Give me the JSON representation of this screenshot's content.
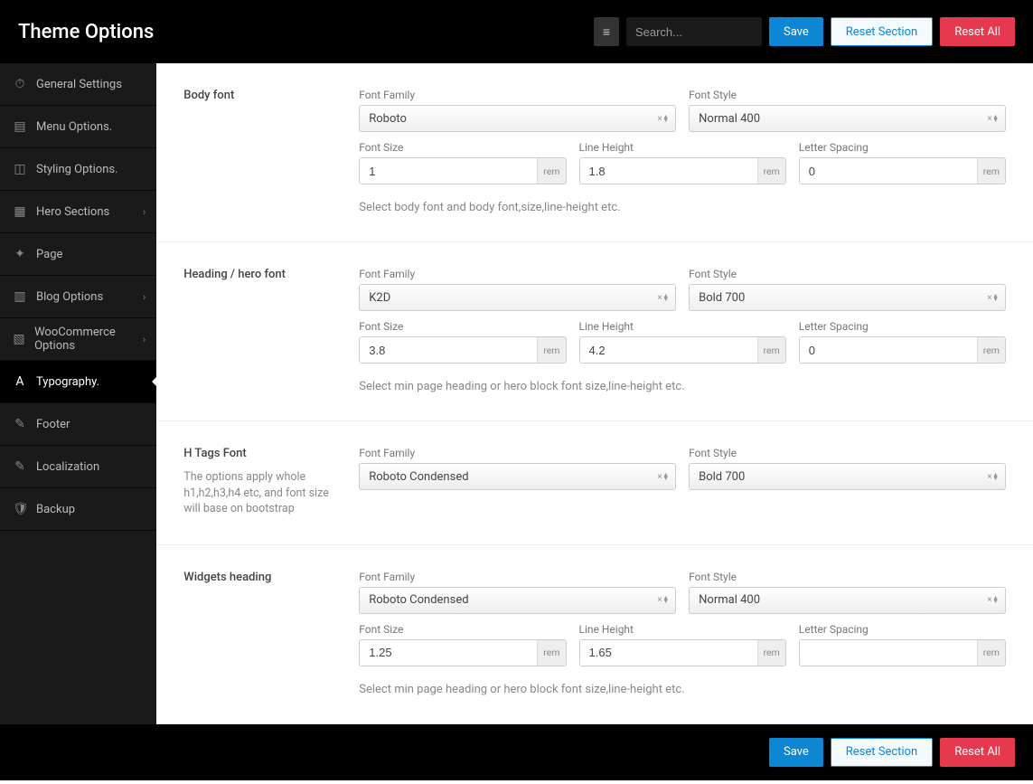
{
  "header": {
    "title": "Theme Options",
    "search_placeholder": "Search...",
    "save": "Save",
    "reset_section": "Reset Section",
    "reset_all": "Reset All"
  },
  "sidebar": {
    "items": [
      {
        "label": "General Settings",
        "icon": "⏱",
        "chevron": false
      },
      {
        "label": "Menu Options.",
        "icon": "▤",
        "chevron": false
      },
      {
        "label": "Styling Options.",
        "icon": "◫",
        "chevron": false
      },
      {
        "label": "Hero Sections",
        "icon": "▦",
        "chevron": true
      },
      {
        "label": "Page",
        "icon": "✦",
        "chevron": false
      },
      {
        "label": "Blog Options",
        "icon": "▥",
        "chevron": true
      },
      {
        "label": "WooCommerce Options",
        "icon": "▧",
        "chevron": true
      },
      {
        "label": "Typography.",
        "icon": "A",
        "chevron": false,
        "active": true
      },
      {
        "label": "Footer",
        "icon": "✎",
        "chevron": false
      },
      {
        "label": "Localization",
        "icon": "✎",
        "chevron": false
      },
      {
        "label": "Backup",
        "icon": "🛡",
        "chevron": false
      }
    ]
  },
  "labels": {
    "font_family": "Font Family",
    "font_style": "Font Style",
    "font_size": "Font Size",
    "line_height": "Line Height",
    "letter_spacing": "Letter Spacing",
    "unit": "rem"
  },
  "sections": [
    {
      "name": "Body font",
      "sub": "",
      "family": "Roboto",
      "style": "Normal 400",
      "size": "1",
      "lh": "1.8",
      "ls": "0",
      "hint": "Select body font and body font,size,line-height etc.",
      "show_sizes": true
    },
    {
      "name": "Heading / hero font",
      "sub": "",
      "family": "K2D",
      "style": "Bold 700",
      "size": "3.8",
      "lh": "4.2",
      "ls": "0",
      "hint": "Select min page heading or hero block font size,line-height etc.",
      "show_sizes": true
    },
    {
      "name": "H Tags Font",
      "sub": "The options apply whole h1,h2,h3,h4 etc, and font size will base on bootstrap",
      "family": "Roboto Condensed",
      "style": "Bold 700",
      "size": "",
      "lh": "",
      "ls": "",
      "hint": "",
      "show_sizes": false
    },
    {
      "name": "Widgets heading",
      "sub": "",
      "family": "Roboto Condensed",
      "style": "Normal 400",
      "size": "1.25",
      "lh": "1.65",
      "ls": "",
      "hint": "Select min page heading or hero block font size,line-height etc.",
      "show_sizes": true
    }
  ],
  "footer": {
    "save": "Save",
    "reset_section": "Reset Section",
    "reset_all": "Reset All"
  }
}
